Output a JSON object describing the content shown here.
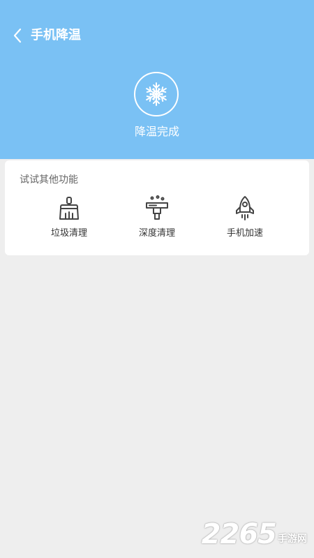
{
  "header": {
    "title": "手机降温",
    "status": "降温完成",
    "background": "#7ac1f4"
  },
  "card": {
    "title": "试试其他功能",
    "features": [
      {
        "label": "垃圾清理",
        "icon": "broom-icon"
      },
      {
        "label": "深度清理",
        "icon": "deep-clean-icon"
      },
      {
        "label": "手机加速",
        "icon": "rocket-icon"
      }
    ]
  },
  "watermark": {
    "number": "2265",
    "text": "手游网"
  }
}
